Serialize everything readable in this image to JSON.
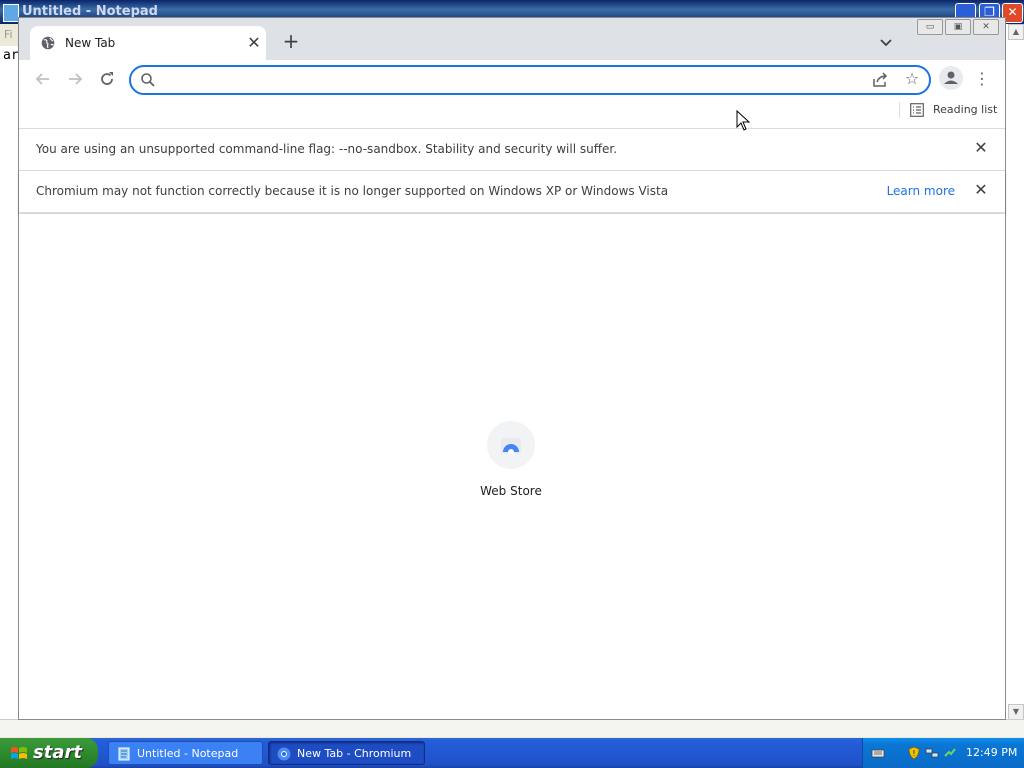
{
  "notepad": {
    "title": "Untitled - Notepad",
    "menu_first": "Fi",
    "text": "ar"
  },
  "browser": {
    "tab": {
      "title": "New Tab"
    },
    "omnibox": {
      "value": "",
      "placeholder": ""
    },
    "reading_list_label": "Reading list",
    "infobars": [
      {
        "message": "You are using an unsupported command-line flag: --no-sandbox. Stability and security will suffer."
      },
      {
        "message": "Chromium may not function correctly because it is no longer supported on Windows XP or Windows Vista",
        "link": "Learn more"
      }
    ],
    "shortcuts": [
      {
        "label": "Web Store"
      }
    ]
  },
  "taskbar": {
    "start_label": "start",
    "tasks": [
      {
        "label": "Untitled - Notepad"
      },
      {
        "label": "New Tab - Chromium"
      }
    ],
    "clock": "12:49 PM"
  },
  "colors": {
    "accent": "#1a73e8",
    "taskbar_blue": "#245edc",
    "start_green": "#2e8b2e"
  }
}
